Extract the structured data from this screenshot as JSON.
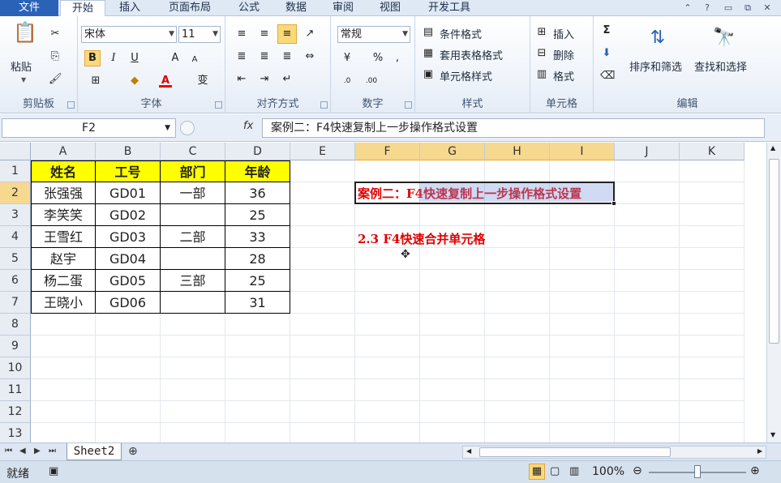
{
  "tabs": {
    "file": "文件",
    "home": "开始",
    "insert": "插入",
    "layout": "页面布局",
    "formulas": "公式",
    "data": "数据",
    "review": "审阅",
    "view": "视图",
    "developer": "开发工具"
  },
  "ribbon": {
    "clipboard": {
      "paste": "粘贴",
      "label": "剪贴板"
    },
    "font": {
      "name": "宋体",
      "size": "11",
      "bold": "B",
      "italic": "I",
      "underline": "U",
      "label": "字体",
      "grow": "A",
      "shrink": "A",
      "phonetic": "变"
    },
    "alignment": {
      "label": "对齐方式"
    },
    "number": {
      "format": "常规",
      "percent": "%",
      "comma": ",",
      "label": "数字"
    },
    "styles": {
      "conditional": "条件格式",
      "table": "套用表格格式",
      "cell": "单元格样式",
      "label": "样式"
    },
    "cells": {
      "insert": "插入",
      "delete": "删除",
      "format": "格式",
      "label": "单元格"
    },
    "editing": {
      "sort": "排序和筛选",
      "find": "查找和选择",
      "sum": "Σ",
      "label": "编辑"
    }
  },
  "formula_bar": {
    "name_box": "F2",
    "fx": "fx",
    "content": "案例二：F4快速复制上一步操作格式设置"
  },
  "columns": [
    "A",
    "B",
    "C",
    "D",
    "E",
    "F",
    "G",
    "H",
    "I",
    "J",
    "K"
  ],
  "rows": [
    "1",
    "2",
    "3",
    "4",
    "5",
    "6",
    "7",
    "8",
    "9",
    "10",
    "11",
    "12",
    "13"
  ],
  "table": {
    "headers": [
      "姓名",
      "工号",
      "部门",
      "年龄"
    ],
    "rows": [
      [
        "张强强",
        "GD01",
        "一部",
        "36"
      ],
      [
        "李笑笑",
        "GD02",
        "",
        "25"
      ],
      [
        "王雪红",
        "GD03",
        "二部",
        "33"
      ],
      [
        "赵宇",
        "GD04",
        "",
        "28"
      ],
      [
        "杨二蛋",
        "GD05",
        "三部",
        "25"
      ],
      [
        "王晓小",
        "GD06",
        "",
        "31"
      ]
    ]
  },
  "annotations": {
    "f2": "案例二：F4快速复制上一步操作格式设置",
    "f4": "2.3 F4快速合并单元格"
  },
  "sheet_tab": "Sheet2",
  "status": {
    "ready": "就绪",
    "zoom": "100%"
  },
  "colors": {
    "header_fill": "#ffff00",
    "red_text": "#e00000",
    "file_tab": "#2a62b8"
  }
}
